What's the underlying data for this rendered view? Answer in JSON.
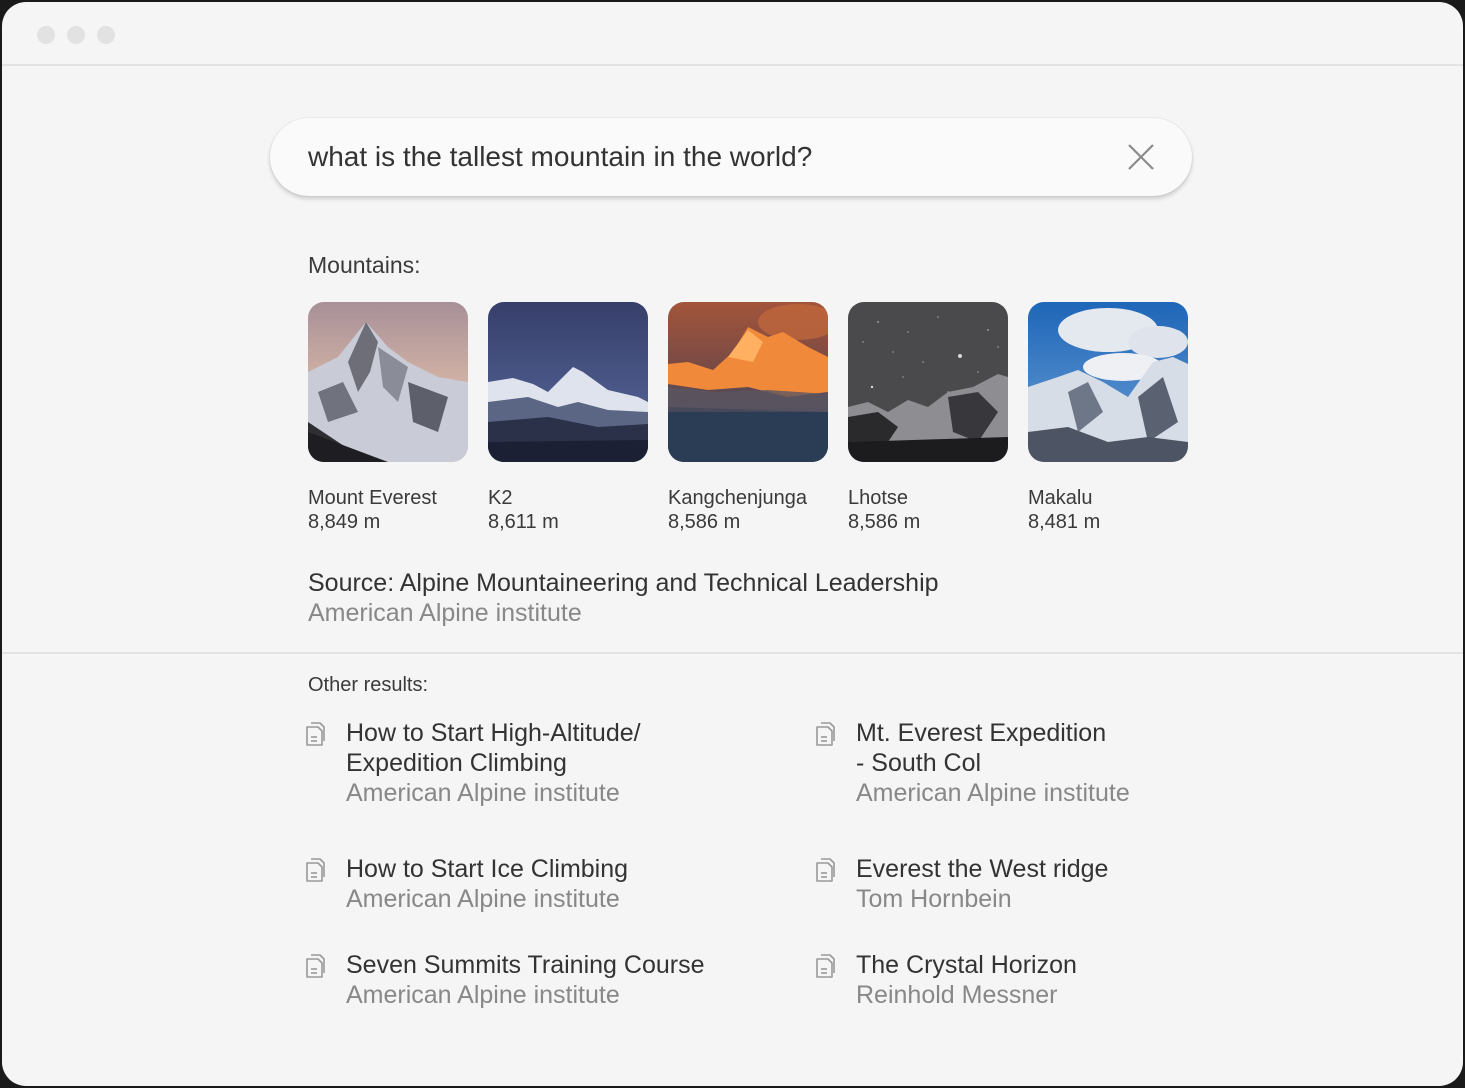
{
  "window": {
    "controls": [
      "close",
      "minimize",
      "maximize"
    ]
  },
  "search": {
    "query": "what is the tallest mountain in the world?",
    "clear_icon": "close-icon"
  },
  "mountains": {
    "label": "Mountains:",
    "items": [
      {
        "name": "Mount Everest",
        "height": "8,849 m",
        "image": "snowy-peak-dusk"
      },
      {
        "name": "K2",
        "height": "8,611 m",
        "image": "snowy-peak-blue-sky"
      },
      {
        "name": "Kangchenjunga",
        "height": "8,586 m",
        "image": "sunset-orange-peak"
      },
      {
        "name": "Lhotse",
        "height": "8,586 m",
        "image": "starry-night-peaks"
      },
      {
        "name": "Makalu",
        "height": "8,481 m",
        "image": "snowy-peak-clouds"
      }
    ]
  },
  "source": {
    "title": "Source: Alpine Mountaineering and Technical Leadership",
    "publisher": "American Alpine institute"
  },
  "other_results": {
    "label": "Other results:",
    "items": [
      {
        "title_lines": [
          "How to Start High-Altitude/",
          "Expedition Climbing"
        ],
        "author": "American Alpine institute",
        "icon": "document-icon"
      },
      {
        "title_lines": [
          "Mt. Everest Expedition",
          "- South Col"
        ],
        "author": "American Alpine institute",
        "icon": "document-icon"
      },
      {
        "title_lines": [
          "How to Start Ice Climbing"
        ],
        "author": "American Alpine institute",
        "icon": "document-icon"
      },
      {
        "title_lines": [
          "Everest the West ridge"
        ],
        "author": "Tom Hornbein",
        "icon": "document-icon"
      },
      {
        "title_lines": [
          "Seven Summits Training Course"
        ],
        "author": "American Alpine institute",
        "icon": "document-icon"
      },
      {
        "title_lines": [
          "The Crystal Horizon"
        ],
        "author": "Reinhold Messner",
        "icon": "document-icon"
      }
    ]
  }
}
